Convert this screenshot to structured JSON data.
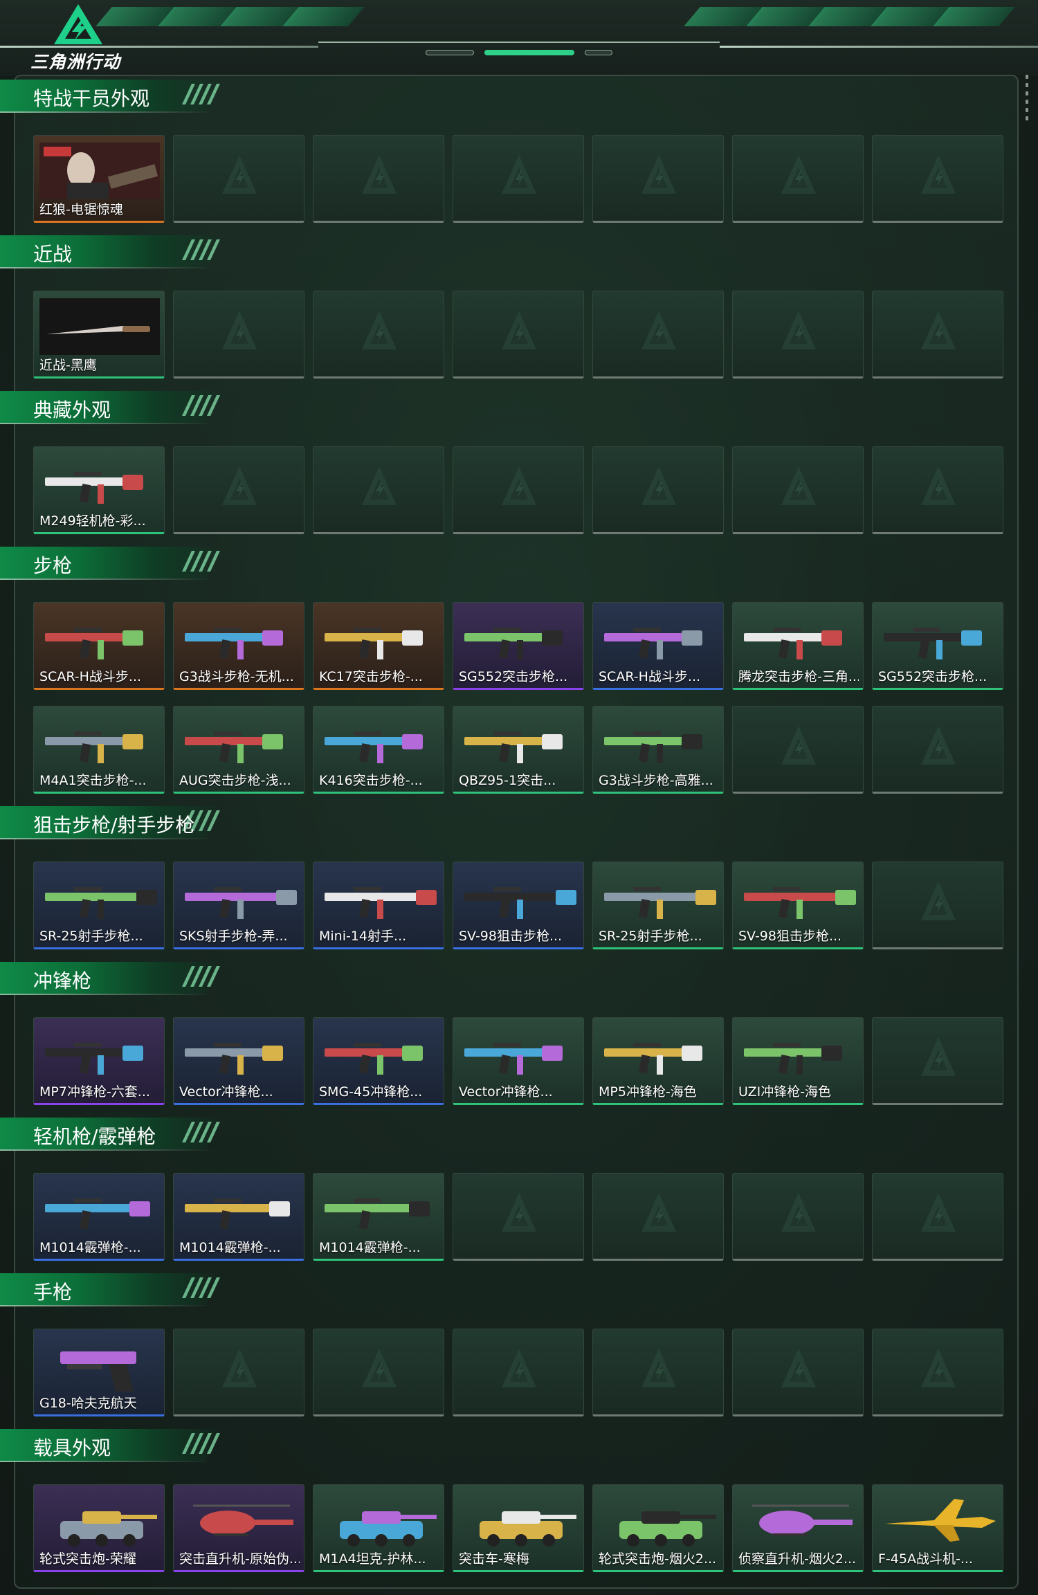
{
  "app": {
    "logo_text": "三角洲行动"
  },
  "sections": [
    {
      "title": "特战干员外观",
      "items": [
        {
          "name": "红狼-电锯惊魂",
          "tier": "orange",
          "icon": "operator-portrait"
        }
      ]
    },
    {
      "title": "近战",
      "items": [
        {
          "name": "近战-黑鹰",
          "tier": "green",
          "icon": "knife"
        }
      ]
    },
    {
      "title": "典藏外观",
      "items": [
        {
          "name": "M249轻机枪-彩...",
          "tier": "green",
          "icon": "machine-gun"
        }
      ]
    },
    {
      "title": "步枪",
      "items": [
        {
          "name": "SCAR-H战斗步...",
          "tier": "orange",
          "icon": "rifle"
        },
        {
          "name": "G3战斗步枪-无机...",
          "tier": "orange",
          "icon": "rifle"
        },
        {
          "name": "KC17突击步枪-...",
          "tier": "orange",
          "icon": "rifle"
        },
        {
          "name": "SG552突击步枪...",
          "tier": "purple",
          "icon": "rifle"
        },
        {
          "name": "SCAR-H战斗步...",
          "tier": "blue",
          "icon": "rifle"
        },
        {
          "name": "腾龙突击步枪-三角...",
          "tier": "green",
          "icon": "rifle"
        },
        {
          "name": "SG552突击步枪...",
          "tier": "green",
          "icon": "rifle"
        },
        {
          "name": "M4A1突击步枪-...",
          "tier": "green",
          "icon": "rifle"
        },
        {
          "name": "AUG突击步枪-浅...",
          "tier": "green",
          "icon": "rifle"
        },
        {
          "name": "K416突击步枪-...",
          "tier": "green",
          "icon": "rifle"
        },
        {
          "name": "QBZ95-1突击...",
          "tier": "green",
          "icon": "rifle"
        },
        {
          "name": "G3战斗步枪-高雅...",
          "tier": "green",
          "icon": "rifle"
        }
      ]
    },
    {
      "title": "狙击步枪/射手步枪",
      "items": [
        {
          "name": "SR-25射手步枪...",
          "tier": "blue",
          "icon": "sniper-rifle"
        },
        {
          "name": "SKS射手步枪-弄...",
          "tier": "blue",
          "icon": "sniper-rifle"
        },
        {
          "name": "Mini-14射手...",
          "tier": "blue",
          "icon": "sniper-rifle"
        },
        {
          "name": "SV-98狙击步枪...",
          "tier": "blue",
          "icon": "sniper-rifle"
        },
        {
          "name": "SR-25射手步枪...",
          "tier": "green",
          "icon": "sniper-rifle"
        },
        {
          "name": "SV-98狙击步枪...",
          "tier": "green",
          "icon": "sniper-rifle"
        }
      ]
    },
    {
      "title": "冲锋枪",
      "items": [
        {
          "name": "MP7冲锋枪-六套...",
          "tier": "purple",
          "icon": "smg"
        },
        {
          "name": "Vector冲锋枪...",
          "tier": "blue",
          "icon": "smg"
        },
        {
          "name": "SMG-45冲锋枪...",
          "tier": "blue",
          "icon": "smg"
        },
        {
          "name": "Vector冲锋枪...",
          "tier": "green",
          "icon": "smg"
        },
        {
          "name": "MP5冲锋枪-海色",
          "tier": "green",
          "icon": "smg"
        },
        {
          "name": "UZI冲锋枪-海色",
          "tier": "green",
          "icon": "smg"
        }
      ]
    },
    {
      "title": "轻机枪/霰弹枪",
      "items": [
        {
          "name": "M1014霰弹枪-...",
          "tier": "blue",
          "icon": "shotgun"
        },
        {
          "name": "M1014霰弹枪-...",
          "tier": "blue",
          "icon": "shotgun"
        },
        {
          "name": "M1014霰弹枪-...",
          "tier": "green",
          "icon": "shotgun"
        }
      ]
    },
    {
      "title": "手枪",
      "items": [
        {
          "name": "G18-哈夫克航天",
          "tier": "blue",
          "icon": "pistol"
        }
      ]
    },
    {
      "title": "载具外观",
      "items": [
        {
          "name": "轮式突击炮-荣耀",
          "tier": "purple",
          "icon": "armored-vehicle"
        },
        {
          "name": "突击直升机-原始伪...",
          "tier": "purple",
          "icon": "helicopter"
        },
        {
          "name": "M1A4坦克-护林...",
          "tier": "green",
          "icon": "tank"
        },
        {
          "name": "突击车-寒梅",
          "tier": "green",
          "icon": "assault-vehicle"
        },
        {
          "name": "轮式突击炮-烟火2...",
          "tier": "green",
          "icon": "armored-vehicle"
        },
        {
          "name": "侦察直升机-烟火2...",
          "tier": "green",
          "icon": "helicopter"
        },
        {
          "name": "F-45A战斗机-...",
          "tier": "green",
          "icon": "fighter-jet"
        }
      ]
    }
  ]
}
